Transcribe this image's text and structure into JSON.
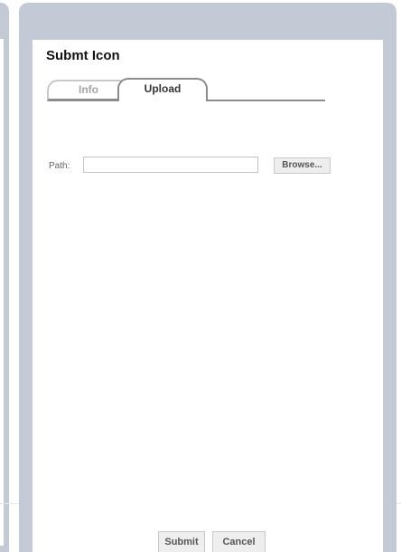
{
  "dialog": {
    "title": "Submt Icon",
    "tabs": [
      {
        "label": "Info",
        "active": false
      },
      {
        "label": "Upload",
        "active": true
      }
    ]
  },
  "upload": {
    "path_label": "Path:",
    "path_value": "",
    "browse_label": "Browse..."
  },
  "footer": {
    "submit_label": "Submit",
    "cancel_label": "Cancel"
  },
  "colors": {
    "frame": "#c3cad6",
    "tab_border_active": "#8c8c8c",
    "tab_text_inactive": "#a4a4a4",
    "button_bg": "#eeeeee"
  }
}
